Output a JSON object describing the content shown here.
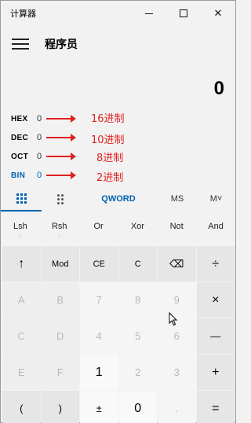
{
  "window": {
    "title": "计算器",
    "minimize_glyph": "",
    "close_glyph": "✕"
  },
  "header": {
    "mode_title": "程序员"
  },
  "display": {
    "value": "0"
  },
  "radix": [
    {
      "name": "HEX",
      "value": "0",
      "note": "16进制"
    },
    {
      "name": "DEC",
      "value": "0",
      "note": "10进制"
    },
    {
      "name": "OCT",
      "value": "0",
      "note": "8进制"
    },
    {
      "name": "BIN",
      "value": "0",
      "note": "2进制"
    }
  ],
  "tabs": {
    "word_size": "QWORD",
    "memory_store": "MS",
    "memory_menu": "M˅"
  },
  "shift_row": [
    {
      "label": "Lsh",
      "sub": "↑"
    },
    {
      "label": "Rsh",
      "sub": "↑"
    },
    {
      "label": "Or",
      "sub": ""
    },
    {
      "label": "Xor",
      "sub": ""
    },
    {
      "label": "Not",
      "sub": ""
    },
    {
      "label": "And",
      "sub": ""
    }
  ],
  "keys": {
    "shift": "↑",
    "mod": "Mod",
    "ce": "CE",
    "c": "C",
    "backspace": "⌫",
    "divide": "÷",
    "a": "A",
    "b": "B",
    "seven": "7",
    "eight": "8",
    "nine": "9",
    "multiply": "×",
    "c_hex": "C",
    "d": "D",
    "four": "4",
    "five": "5",
    "six": "6",
    "minus": "—",
    "e": "E",
    "f": "F",
    "one": "1",
    "two": "2",
    "three": "3",
    "plus": "+",
    "lparen": "(",
    "rparen": ")",
    "negate": "±",
    "zero": "0",
    "decimal": ".",
    "equals": "="
  },
  "colors": {
    "accent": "#0063b1",
    "annotation": "#e02020",
    "background": "#f2f2f2"
  }
}
